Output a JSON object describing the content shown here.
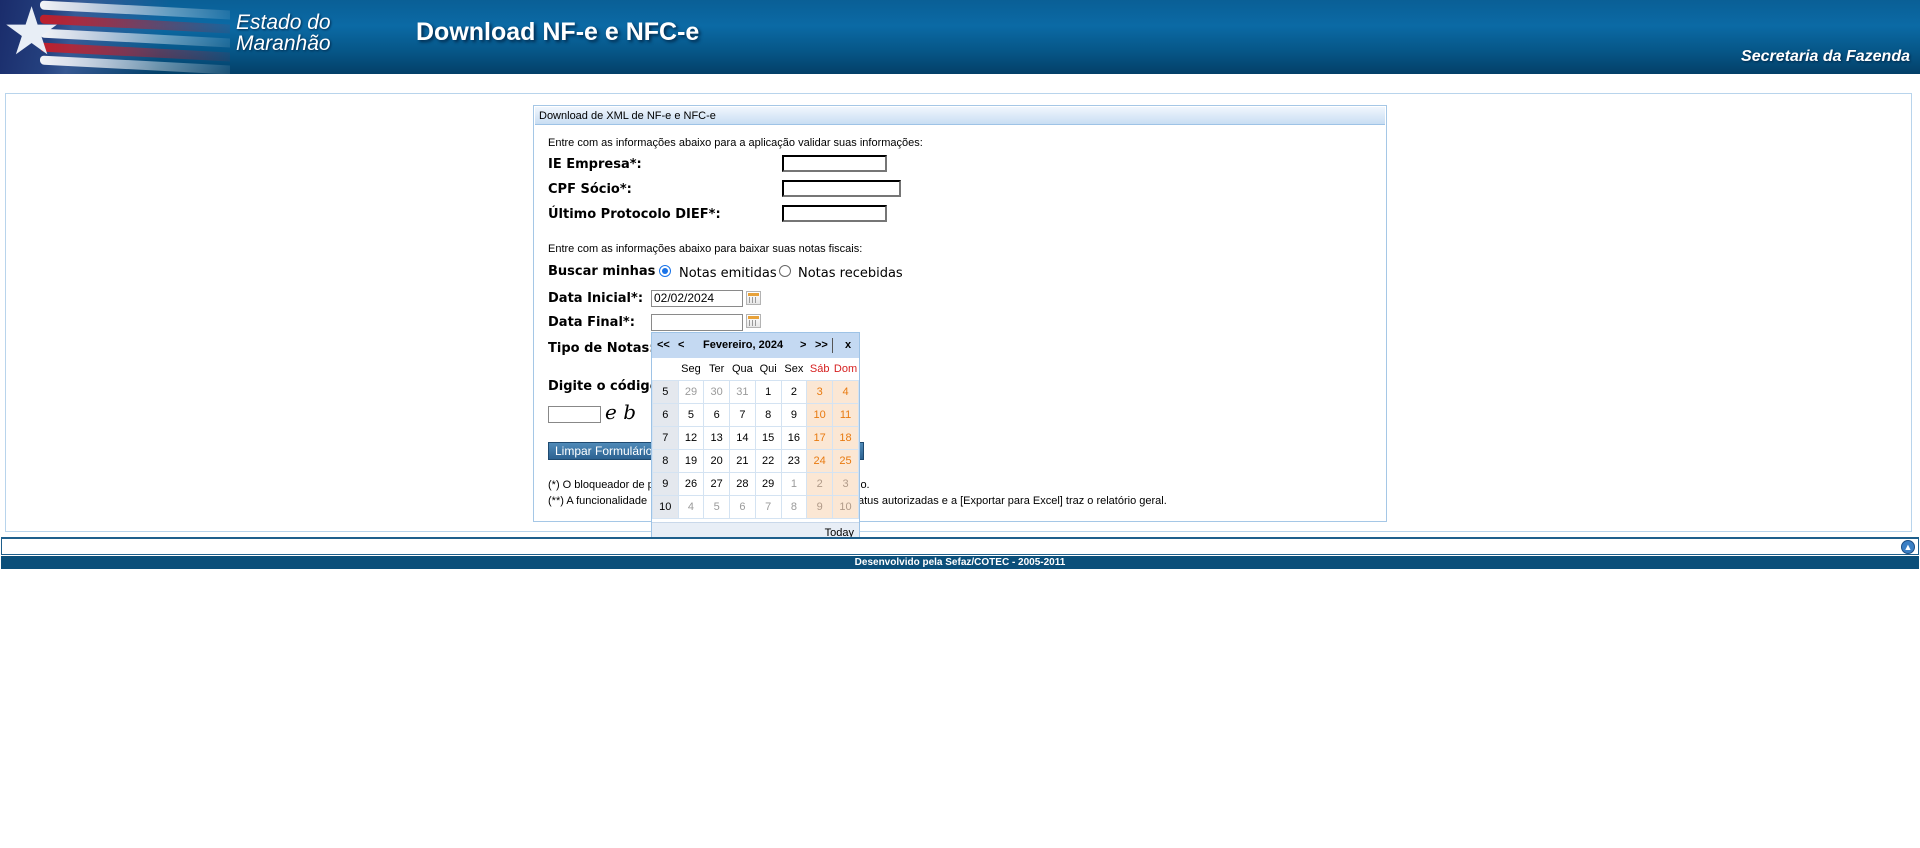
{
  "header": {
    "state_line1": "Estado do",
    "state_line2": "Maranhão",
    "app_title": "Download NF-e e NFC-e",
    "department": "Secretaria da Fazenda"
  },
  "panel": {
    "title": "Download de XML de NF-e e NFC-e",
    "intro_validate": "Entre com as informações abaixo para a aplicação validar suas informações:",
    "ie_label": "IE Empresa*:",
    "ie_value": "",
    "cpf_label": "CPF Sócio*:",
    "cpf_value": "",
    "protocol_label": "Último Protocolo DIEF*:",
    "protocol_value": "",
    "intro_download": "Entre com as informações abaixo para baixar suas notas fiscais:",
    "buscar_label": "Buscar minhas",
    "radio_emitidas": "Notas emitidas",
    "radio_recebidas": "Notas recebidas",
    "selected_radio": "Notas emitidas",
    "data_inicial_label": "Data Inicial*:",
    "data_inicial_value": "02/02/2024",
    "data_final_label": "Data Final*:",
    "data_final_value": "",
    "tipo_label": "Tipo de Notas:",
    "captcha_label": "Digite o código",
    "captcha_text": "e b",
    "clear_button": "Limpar Formulário",
    "note1_a": "(*) O bloqueador de p",
    "note1_b": "lo.",
    "note2_a": "(**) A funcionalidade",
    "note2_b": "atus autorizadas e a [Exportar para Excel] traz o relatório geral."
  },
  "calendar": {
    "nav_prev_year": "<<",
    "nav_prev_month": "<",
    "month_title": "Fevereiro, 2024",
    "nav_next_month": ">",
    "nav_next_year": ">>",
    "close": "x",
    "day_names": [
      "Seg",
      "Ter",
      "Qua",
      "Qui",
      "Sex",
      "Sáb",
      "Dom"
    ],
    "weeks": [
      {
        "wk": "5",
        "days": [
          "29",
          "30",
          "31",
          "1",
          "2",
          "3",
          "4"
        ]
      },
      {
        "wk": "6",
        "days": [
          "5",
          "6",
          "7",
          "8",
          "9",
          "10",
          "11"
        ]
      },
      {
        "wk": "7",
        "days": [
          "12",
          "13",
          "14",
          "15",
          "16",
          "17",
          "18"
        ]
      },
      {
        "wk": "8",
        "days": [
          "19",
          "20",
          "21",
          "22",
          "23",
          "24",
          "25"
        ]
      },
      {
        "wk": "9",
        "days": [
          "26",
          "27",
          "28",
          "29",
          "1",
          "2",
          "3"
        ]
      },
      {
        "wk": "10",
        "days": [
          "4",
          "5",
          "6",
          "7",
          "8",
          "9",
          "10"
        ]
      }
    ],
    "today_label": "Today"
  },
  "footer": {
    "credit": "Desenvolvido pela Sefaz/COTEC - 2005-2011"
  },
  "icons": {
    "star": "star-icon",
    "calendar": "calendar-icon",
    "scroll_top": "arrow-up-icon"
  }
}
